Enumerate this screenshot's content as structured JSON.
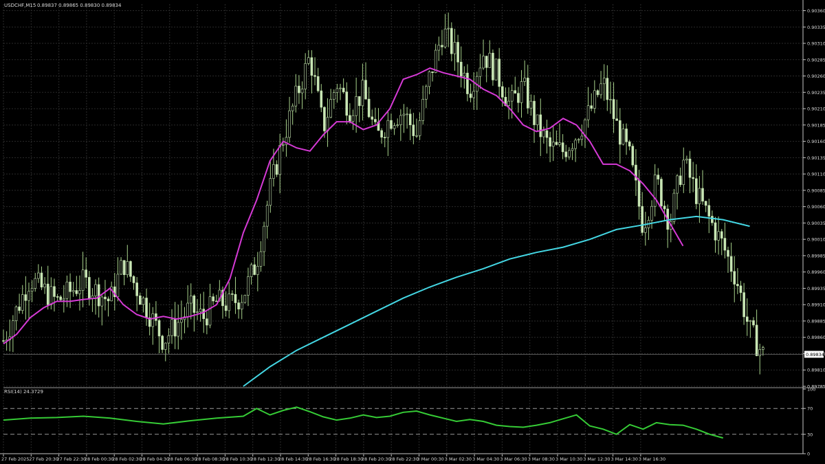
{
  "header": {
    "symbol_label": "USDCHF,M15",
    "ohlc_label": "0.89837 0.89865 0.89830 0.89834"
  },
  "colors": {
    "background": "#000000",
    "grid": "#2b2b2b",
    "axis": "#c8c8c8",
    "candle_body": "#c8e6b4",
    "candle_wick": "#a9d48c",
    "ma_fast": "#d63ad6",
    "ma_slow": "#44d7e4",
    "rsi_line": "#36cc36",
    "price_tag_bg": "#ffffff",
    "price_tag_text": "#000000"
  },
  "chart_data": [
    {
      "type": "candlestick",
      "symbol": "USDCHF",
      "timeframe": "M15",
      "ylim": [
        0.89785,
        0.9037
      ],
      "yticks": [
        "0.90360",
        "0.90335",
        "0.90310",
        "0.90285",
        "0.90260",
        "0.90235",
        "0.90210",
        "0.90185",
        "0.90160",
        "0.90135",
        "0.90110",
        "0.90085",
        "0.90060",
        "0.90035",
        "0.90010",
        "0.89985",
        "0.89960",
        "0.89935",
        "0.89910",
        "0.89885",
        "0.89860",
        "0.89835",
        "0.89810",
        "0.89785"
      ],
      "last_price": "0.89834",
      "x_labels": [
        "27 Feb 2025",
        "27 Feb 20:30",
        "27 Feb 22:30",
        "28 Feb 00:30",
        "28 Feb 02:30",
        "28 Feb 04:30",
        "28 Feb 06:30",
        "28 Feb 08:30",
        "28 Feb 10:30",
        "28 Feb 12:30",
        "28 Feb 14:30",
        "28 Feb 16:30",
        "28 Feb 18:30",
        "28 Feb 20:30",
        "28 Feb 22:30",
        "3 Mar 00:30",
        "3 Mar 02:30",
        "3 Mar 04:30",
        "3 Mar 06:30",
        "3 Mar 08:30",
        "3 Mar 10:30",
        "3 Mar 12:30",
        "3 Mar 14:30",
        "3 Mar 16:30"
      ],
      "close_path": [
        [
          0,
          0.89855
        ],
        [
          2,
          0.8995
        ],
        [
          4,
          0.89915
        ],
        [
          6,
          0.89945
        ],
        [
          8,
          0.89915
        ],
        [
          9,
          0.89975
        ],
        [
          10,
          0.89935
        ],
        [
          11,
          0.89895
        ],
        [
          12,
          0.89855
        ],
        [
          13,
          0.8988
        ],
        [
          14,
          0.89905
        ],
        [
          15,
          0.8989
        ],
        [
          16,
          0.89915
        ],
        [
          17,
          0.8991
        ],
        [
          18,
          0.89925
        ],
        [
          19,
          0.89975
        ],
        [
          20,
          0.90085
        ],
        [
          21,
          0.90165
        ],
        [
          22,
          0.9023
        ],
        [
          23,
          0.9029
        ],
        [
          24,
          0.9018
        ],
        [
          25,
          0.9025
        ],
        [
          26,
          0.9021
        ],
        [
          27,
          0.90235
        ],
        [
          28,
          0.90165
        ],
        [
          29,
          0.90195
        ],
        [
          30,
          0.90205
        ],
        [
          31,
          0.9017
        ],
        [
          32,
          0.9026
        ],
        [
          33,
          0.9033
        ],
        [
          34,
          0.9029
        ],
        [
          35,
          0.9024
        ],
        [
          36,
          0.90295
        ],
        [
          37,
          0.90265
        ],
        [
          38,
          0.90215
        ],
        [
          39,
          0.90245
        ],
        [
          40,
          0.90185
        ],
        [
          41,
          0.9015
        ],
        [
          42,
          0.90145
        ],
        [
          43,
          0.9017
        ],
        [
          44,
          0.90205
        ],
        [
          45,
          0.9025
        ],
        [
          46,
          0.90185
        ],
        [
          47,
          0.90135
        ],
        [
          48,
          0.9003
        ],
        [
          49,
          0.901
        ],
        [
          50,
          0.90035
        ],
        [
          51,
          0.9013
        ],
        [
          52,
          0.9008
        ],
        [
          53,
          0.9004
        ],
        [
          54,
          0.9
        ],
        [
          55,
          0.8995
        ],
        [
          56,
          0.8987
        ],
        [
          57,
          0.89834
        ]
      ],
      "series": [
        {
          "name": "MA fast",
          "values": [
            [
              0,
              0.8985
            ],
            [
              1,
              0.89865
            ],
            [
              2,
              0.8989
            ],
            [
              3,
              0.89905
            ],
            [
              4,
              0.89915
            ],
            [
              5,
              0.89915
            ],
            [
              6,
              0.89918
            ],
            [
              7,
              0.8992
            ],
            [
              8,
              0.89935
            ],
            [
              9,
              0.8991
            ],
            [
              10,
              0.89895
            ],
            [
              11,
              0.89888
            ],
            [
              12,
              0.89892
            ],
            [
              13,
              0.89888
            ],
            [
              14,
              0.89892
            ],
            [
              15,
              0.89898
            ],
            [
              16,
              0.8991
            ],
            [
              17,
              0.8995
            ],
            [
              18,
              0.9002
            ],
            [
              19,
              0.9007
            ],
            [
              20,
              0.9013
            ],
            [
              21,
              0.9016
            ],
            [
              22,
              0.9015
            ],
            [
              23,
              0.90145
            ],
            [
              24,
              0.9017
            ],
            [
              25,
              0.9019
            ],
            [
              26,
              0.9019
            ],
            [
              27,
              0.90178
            ],
            [
              28,
              0.90185
            ],
            [
              29,
              0.9021
            ],
            [
              30,
              0.90255
            ],
            [
              31,
              0.90262
            ],
            [
              32,
              0.90272
            ],
            [
              33,
              0.90265
            ],
            [
              34,
              0.9026
            ],
            [
              35,
              0.90255
            ],
            [
              36,
              0.9024
            ],
            [
              37,
              0.9023
            ],
            [
              38,
              0.9021
            ],
            [
              39,
              0.90185
            ],
            [
              40,
              0.90175
            ],
            [
              41,
              0.9018
            ],
            [
              42,
              0.90195
            ],
            [
              43,
              0.90185
            ],
            [
              44,
              0.9016
            ],
            [
              45,
              0.90125
            ],
            [
              46,
              0.90125
            ],
            [
              47,
              0.90115
            ],
            [
              48,
              0.90095
            ],
            [
              49,
              0.9007
            ],
            [
              50,
              0.90035
            ],
            [
              51,
              0.9
            ]
          ]
        },
        {
          "name": "MA slow",
          "values": [
            [
              18,
              0.89785
            ],
            [
              20,
              0.89815
            ],
            [
              22,
              0.8984
            ],
            [
              24,
              0.8986
            ],
            [
              26,
              0.8988
            ],
            [
              28,
              0.899
            ],
            [
              30,
              0.8992
            ],
            [
              32,
              0.89937
            ],
            [
              34,
              0.89952
            ],
            [
              36,
              0.89965
            ],
            [
              38,
              0.8998
            ],
            [
              40,
              0.8999
            ],
            [
              42,
              0.89998
            ],
            [
              44,
              0.9001
            ],
            [
              46,
              0.90025
            ],
            [
              48,
              0.90032
            ],
            [
              50,
              0.9004
            ],
            [
              52,
              0.90045
            ],
            [
              54,
              0.9004
            ],
            [
              56,
              0.9003
            ]
          ]
        }
      ]
    },
    {
      "type": "line",
      "title": "RSI(14) 24.3729",
      "ylim": [
        0,
        100
      ],
      "yticks": [
        "100",
        "70",
        "30",
        "0"
      ],
      "levels": [
        70,
        30
      ],
      "series": [
        {
          "values": [
            [
              0,
              52
            ],
            [
              2,
              55
            ],
            [
              4,
              56
            ],
            [
              6,
              58
            ],
            [
              8,
              55
            ],
            [
              10,
              50
            ],
            [
              12,
              46
            ],
            [
              14,
              51
            ],
            [
              16,
              55
            ],
            [
              18,
              58
            ],
            [
              19,
              70
            ],
            [
              20,
              60
            ],
            [
              21,
              67
            ],
            [
              22,
              72
            ],
            [
              23,
              65
            ],
            [
              24,
              57
            ],
            [
              25,
              52
            ],
            [
              26,
              55
            ],
            [
              27,
              60
            ],
            [
              28,
              56
            ],
            [
              29,
              58
            ],
            [
              30,
              64
            ],
            [
              31,
              66
            ],
            [
              32,
              60
            ],
            [
              33,
              55
            ],
            [
              34,
              50
            ],
            [
              35,
              53
            ],
            [
              36,
              50
            ],
            [
              37,
              44
            ],
            [
              38,
              42
            ],
            [
              39,
              41
            ],
            [
              40,
              44
            ],
            [
              41,
              48
            ],
            [
              42,
              54
            ],
            [
              43,
              60
            ],
            [
              44,
              43
            ],
            [
              45,
              38
            ],
            [
              46,
              30
            ],
            [
              47,
              45
            ],
            [
              48,
              38
            ],
            [
              49,
              48
            ],
            [
              50,
              45
            ],
            [
              51,
              44
            ],
            [
              52,
              38
            ],
            [
              53,
              30
            ],
            [
              54,
              24.37
            ]
          ]
        }
      ]
    }
  ]
}
